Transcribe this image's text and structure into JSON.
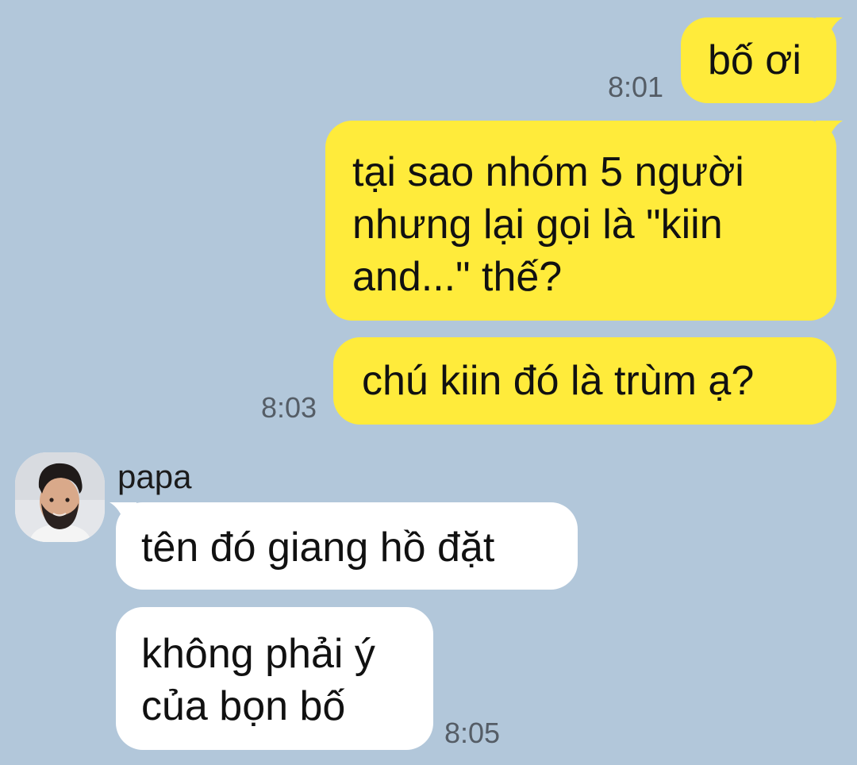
{
  "conversation": {
    "outgoing": [
      {
        "text": "bố ơi",
        "time": "8:01"
      },
      {
        "lines": [
          "tại sao nhóm 5 người",
          "nhưng lại gọi là \"kiin",
          "and...\" thế?"
        ]
      },
      {
        "text": "chú kiin đó là trùm ạ?",
        "time": "8:03"
      }
    ],
    "contact": {
      "name": "papa",
      "avatar_icon": "bearded-man-avatar"
    },
    "incoming": [
      {
        "text": "tên đó giang hồ đặt"
      },
      {
        "lines": [
          "không phải ý",
          "của bọn bố"
        ],
        "time": "8:05"
      }
    ]
  },
  "colors": {
    "background": "#b2c7da",
    "outgoing_bubble": "#ffeb3b",
    "incoming_bubble": "#ffffff",
    "timestamp": "#555d66"
  }
}
